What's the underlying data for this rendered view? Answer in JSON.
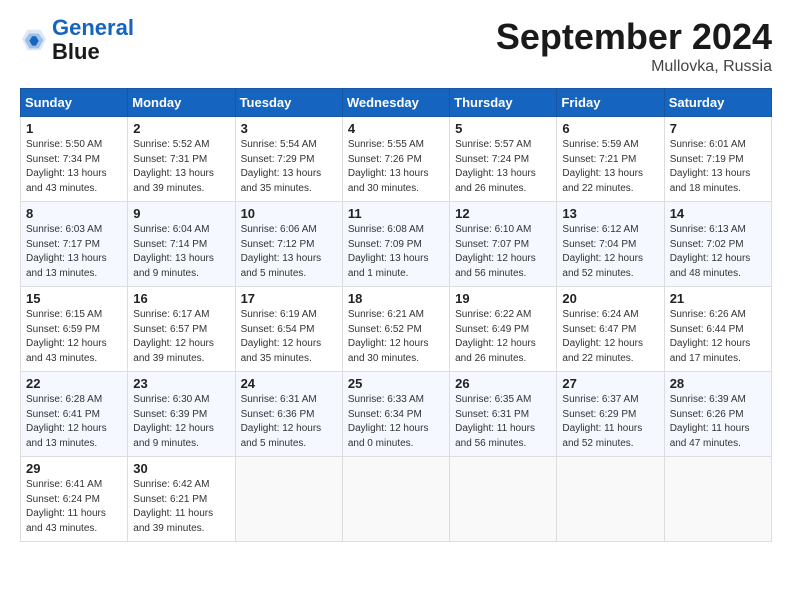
{
  "header": {
    "logo_line1": "General",
    "logo_line2": "Blue",
    "month": "September 2024",
    "location": "Mullovka, Russia"
  },
  "days_of_week": [
    "Sunday",
    "Monday",
    "Tuesday",
    "Wednesday",
    "Thursday",
    "Friday",
    "Saturday"
  ],
  "weeks": [
    [
      {
        "day": "1",
        "lines": [
          "Sunrise: 5:50 AM",
          "Sunset: 7:34 PM",
          "Daylight: 13 hours",
          "and 43 minutes."
        ]
      },
      {
        "day": "2",
        "lines": [
          "Sunrise: 5:52 AM",
          "Sunset: 7:31 PM",
          "Daylight: 13 hours",
          "and 39 minutes."
        ]
      },
      {
        "day": "3",
        "lines": [
          "Sunrise: 5:54 AM",
          "Sunset: 7:29 PM",
          "Daylight: 13 hours",
          "and 35 minutes."
        ]
      },
      {
        "day": "4",
        "lines": [
          "Sunrise: 5:55 AM",
          "Sunset: 7:26 PM",
          "Daylight: 13 hours",
          "and 30 minutes."
        ]
      },
      {
        "day": "5",
        "lines": [
          "Sunrise: 5:57 AM",
          "Sunset: 7:24 PM",
          "Daylight: 13 hours",
          "and 26 minutes."
        ]
      },
      {
        "day": "6",
        "lines": [
          "Sunrise: 5:59 AM",
          "Sunset: 7:21 PM",
          "Daylight: 13 hours",
          "and 22 minutes."
        ]
      },
      {
        "day": "7",
        "lines": [
          "Sunrise: 6:01 AM",
          "Sunset: 7:19 PM",
          "Daylight: 13 hours",
          "and 18 minutes."
        ]
      }
    ],
    [
      {
        "day": "8",
        "lines": [
          "Sunrise: 6:03 AM",
          "Sunset: 7:17 PM",
          "Daylight: 13 hours",
          "and 13 minutes."
        ]
      },
      {
        "day": "9",
        "lines": [
          "Sunrise: 6:04 AM",
          "Sunset: 7:14 PM",
          "Daylight: 13 hours",
          "and 9 minutes."
        ]
      },
      {
        "day": "10",
        "lines": [
          "Sunrise: 6:06 AM",
          "Sunset: 7:12 PM",
          "Daylight: 13 hours",
          "and 5 minutes."
        ]
      },
      {
        "day": "11",
        "lines": [
          "Sunrise: 6:08 AM",
          "Sunset: 7:09 PM",
          "Daylight: 13 hours",
          "and 1 minute."
        ]
      },
      {
        "day": "12",
        "lines": [
          "Sunrise: 6:10 AM",
          "Sunset: 7:07 PM",
          "Daylight: 12 hours",
          "and 56 minutes."
        ]
      },
      {
        "day": "13",
        "lines": [
          "Sunrise: 6:12 AM",
          "Sunset: 7:04 PM",
          "Daylight: 12 hours",
          "and 52 minutes."
        ]
      },
      {
        "day": "14",
        "lines": [
          "Sunrise: 6:13 AM",
          "Sunset: 7:02 PM",
          "Daylight: 12 hours",
          "and 48 minutes."
        ]
      }
    ],
    [
      {
        "day": "15",
        "lines": [
          "Sunrise: 6:15 AM",
          "Sunset: 6:59 PM",
          "Daylight: 12 hours",
          "and 43 minutes."
        ]
      },
      {
        "day": "16",
        "lines": [
          "Sunrise: 6:17 AM",
          "Sunset: 6:57 PM",
          "Daylight: 12 hours",
          "and 39 minutes."
        ]
      },
      {
        "day": "17",
        "lines": [
          "Sunrise: 6:19 AM",
          "Sunset: 6:54 PM",
          "Daylight: 12 hours",
          "and 35 minutes."
        ]
      },
      {
        "day": "18",
        "lines": [
          "Sunrise: 6:21 AM",
          "Sunset: 6:52 PM",
          "Daylight: 12 hours",
          "and 30 minutes."
        ]
      },
      {
        "day": "19",
        "lines": [
          "Sunrise: 6:22 AM",
          "Sunset: 6:49 PM",
          "Daylight: 12 hours",
          "and 26 minutes."
        ]
      },
      {
        "day": "20",
        "lines": [
          "Sunrise: 6:24 AM",
          "Sunset: 6:47 PM",
          "Daylight: 12 hours",
          "and 22 minutes."
        ]
      },
      {
        "day": "21",
        "lines": [
          "Sunrise: 6:26 AM",
          "Sunset: 6:44 PM",
          "Daylight: 12 hours",
          "and 17 minutes."
        ]
      }
    ],
    [
      {
        "day": "22",
        "lines": [
          "Sunrise: 6:28 AM",
          "Sunset: 6:41 PM",
          "Daylight: 12 hours",
          "and 13 minutes."
        ]
      },
      {
        "day": "23",
        "lines": [
          "Sunrise: 6:30 AM",
          "Sunset: 6:39 PM",
          "Daylight: 12 hours",
          "and 9 minutes."
        ]
      },
      {
        "day": "24",
        "lines": [
          "Sunrise: 6:31 AM",
          "Sunset: 6:36 PM",
          "Daylight: 12 hours",
          "and 5 minutes."
        ]
      },
      {
        "day": "25",
        "lines": [
          "Sunrise: 6:33 AM",
          "Sunset: 6:34 PM",
          "Daylight: 12 hours",
          "and 0 minutes."
        ]
      },
      {
        "day": "26",
        "lines": [
          "Sunrise: 6:35 AM",
          "Sunset: 6:31 PM",
          "Daylight: 11 hours",
          "and 56 minutes."
        ]
      },
      {
        "day": "27",
        "lines": [
          "Sunrise: 6:37 AM",
          "Sunset: 6:29 PM",
          "Daylight: 11 hours",
          "and 52 minutes."
        ]
      },
      {
        "day": "28",
        "lines": [
          "Sunrise: 6:39 AM",
          "Sunset: 6:26 PM",
          "Daylight: 11 hours",
          "and 47 minutes."
        ]
      }
    ],
    [
      {
        "day": "29",
        "lines": [
          "Sunrise: 6:41 AM",
          "Sunset: 6:24 PM",
          "Daylight: 11 hours",
          "and 43 minutes."
        ]
      },
      {
        "day": "30",
        "lines": [
          "Sunrise: 6:42 AM",
          "Sunset: 6:21 PM",
          "Daylight: 11 hours",
          "and 39 minutes."
        ]
      },
      {
        "day": "",
        "lines": []
      },
      {
        "day": "",
        "lines": []
      },
      {
        "day": "",
        "lines": []
      },
      {
        "day": "",
        "lines": []
      },
      {
        "day": "",
        "lines": []
      }
    ]
  ]
}
